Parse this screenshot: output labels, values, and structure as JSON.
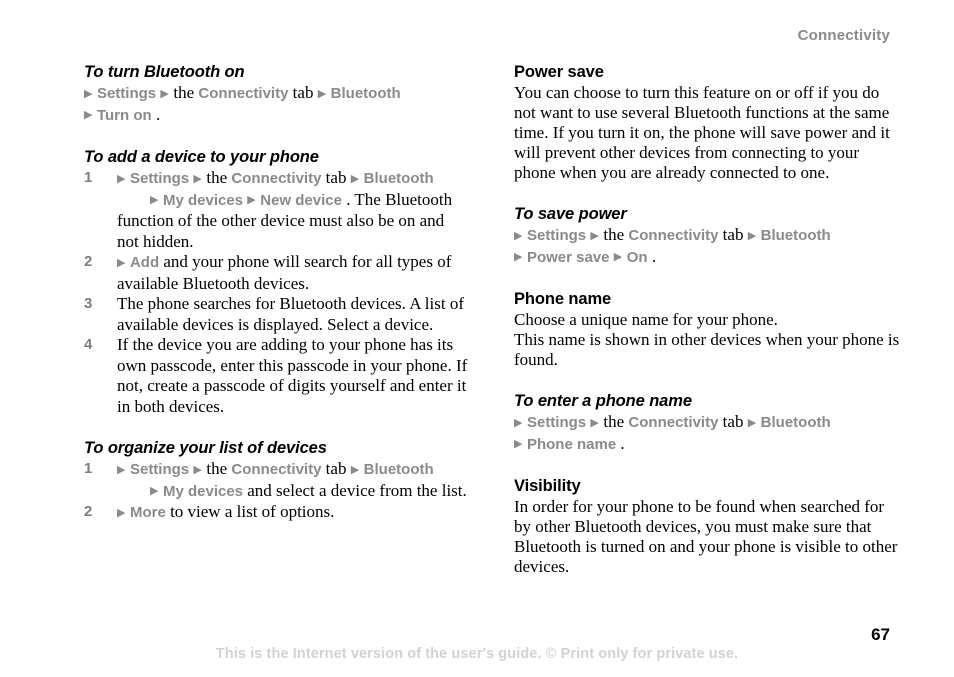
{
  "header": {
    "chapter": "Connectivity"
  },
  "footer": {
    "note": "This is the Internet version of the user's guide. © Print only for private use.",
    "page_number": "67"
  },
  "icons": {
    "menu_arrow": "▶"
  },
  "colors": {
    "ui_term_gray": "#8a8a8a",
    "step_number_gray": "#7d7d7d",
    "header_gray": "#8a8a8a",
    "footer_gray": "#d2d2d2",
    "body_black": "#000000"
  },
  "left_column": {
    "sections": [
      {
        "heading": "To turn Bluetooth on",
        "heading_style": "task",
        "lines": [
          {
            "type": "path",
            "parts": [
              {
                "t": "arrow"
              },
              {
                "t": "ui",
                "v": "Settings"
              },
              {
                "t": "arrow"
              },
              {
                "t": "plain",
                "v": "the "
              },
              {
                "t": "ui",
                "v": "Connectivity"
              },
              {
                "t": "plain",
                "v": " tab "
              },
              {
                "t": "arrow"
              },
              {
                "t": "ui",
                "v": "Bluetooth"
              }
            ]
          },
          {
            "type": "path",
            "parts": [
              {
                "t": "arrow"
              },
              {
                "t": "ui",
                "v": "Turn on"
              },
              {
                "t": "plain",
                "v": "."
              }
            ]
          }
        ]
      },
      {
        "heading": "To add a device to your phone",
        "heading_style": "task",
        "steps": [
          {
            "num": "1",
            "lines": [
              {
                "type": "path",
                "parts": [
                  {
                    "t": "arrow"
                  },
                  {
                    "t": "ui",
                    "v": "Settings"
                  },
                  {
                    "t": "arrow"
                  },
                  {
                    "t": "plain",
                    "v": "the "
                  },
                  {
                    "t": "ui",
                    "v": "Connectivity"
                  },
                  {
                    "t": "plain",
                    "v": " tab "
                  },
                  {
                    "t": "arrow"
                  },
                  {
                    "t": "ui",
                    "v": "Bluetooth"
                  }
                ]
              },
              {
                "type": "path-indent",
                "parts": [
                  {
                    "t": "arrow"
                  },
                  {
                    "t": "ui",
                    "v": "My devices"
                  },
                  {
                    "t": "arrow"
                  },
                  {
                    "t": "ui",
                    "v": "New device"
                  },
                  {
                    "t": "plain",
                    "v": ". The Bluetooth"
                  }
                ]
              },
              {
                "type": "plain",
                "parts": [
                  {
                    "t": "plain",
                    "v": "function of the other device must also be on and not hidden."
                  }
                ]
              }
            ]
          },
          {
            "num": "2",
            "lines": [
              {
                "type": "path",
                "parts": [
                  {
                    "t": "arrow"
                  },
                  {
                    "t": "ui",
                    "v": "Add"
                  },
                  {
                    "t": "plain",
                    "v": " and your phone will search for all types of available Bluetooth devices."
                  }
                ]
              }
            ]
          },
          {
            "num": "3",
            "lines": [
              {
                "type": "plain",
                "parts": [
                  {
                    "t": "plain",
                    "v": "The phone searches for Bluetooth devices. A list of available devices is displayed. Select a device."
                  }
                ]
              }
            ]
          },
          {
            "num": "4",
            "lines": [
              {
                "type": "plain",
                "parts": [
                  {
                    "t": "plain",
                    "v": "If the device you are adding to your phone has its own passcode, enter this passcode in your phone. If not, create a passcode of digits yourself and enter it in both devices."
                  }
                ]
              }
            ]
          }
        ]
      },
      {
        "heading": "To organize your list of devices",
        "heading_style": "task",
        "steps": [
          {
            "num": "1",
            "lines": [
              {
                "type": "path",
                "parts": [
                  {
                    "t": "arrow"
                  },
                  {
                    "t": "ui",
                    "v": "Settings"
                  },
                  {
                    "t": "arrow"
                  },
                  {
                    "t": "plain",
                    "v": "the "
                  },
                  {
                    "t": "ui",
                    "v": "Connectivity"
                  },
                  {
                    "t": "plain",
                    "v": " tab "
                  },
                  {
                    "t": "arrow"
                  },
                  {
                    "t": "ui",
                    "v": "Bluetooth"
                  }
                ]
              },
              {
                "type": "path-indent",
                "parts": [
                  {
                    "t": "arrow"
                  },
                  {
                    "t": "ui",
                    "v": "My devices"
                  },
                  {
                    "t": "plain",
                    "v": " and select a device from the list."
                  }
                ]
              }
            ]
          },
          {
            "num": "2",
            "lines": [
              {
                "type": "path",
                "parts": [
                  {
                    "t": "arrow"
                  },
                  {
                    "t": "ui",
                    "v": "More"
                  },
                  {
                    "t": "plain",
                    "v": " to view a list of options."
                  }
                ]
              }
            ]
          }
        ]
      }
    ]
  },
  "right_column": {
    "sections": [
      {
        "heading": "Power save",
        "heading_style": "topic",
        "lines": [
          {
            "type": "plain",
            "parts": [
              {
                "t": "plain",
                "v": "You can choose to turn this feature on or off if you do not want to use several Bluetooth functions at the same time. If you turn it on, the phone will save power and it will prevent other devices from connecting to your phone when you are already connected to one."
              }
            ]
          }
        ]
      },
      {
        "heading": "To save power",
        "heading_style": "task",
        "lines": [
          {
            "type": "path",
            "parts": [
              {
                "t": "arrow"
              },
              {
                "t": "ui",
                "v": "Settings"
              },
              {
                "t": "arrow"
              },
              {
                "t": "plain",
                "v": "the "
              },
              {
                "t": "ui",
                "v": "Connectivity"
              },
              {
                "t": "plain",
                "v": " tab "
              },
              {
                "t": "arrow"
              },
              {
                "t": "ui",
                "v": "Bluetooth"
              }
            ]
          },
          {
            "type": "path",
            "parts": [
              {
                "t": "arrow"
              },
              {
                "t": "ui",
                "v": "Power save"
              },
              {
                "t": "arrow"
              },
              {
                "t": "ui",
                "v": "On"
              },
              {
                "t": "plain",
                "v": "."
              }
            ]
          }
        ]
      },
      {
        "heading": "Phone name",
        "heading_style": "topic",
        "lines": [
          {
            "type": "plain",
            "parts": [
              {
                "t": "plain",
                "v": "Choose a unique name for your phone."
              }
            ]
          },
          {
            "type": "plain",
            "parts": [
              {
                "t": "plain",
                "v": "This name is shown in other devices when your phone is found."
              }
            ]
          }
        ]
      },
      {
        "heading": "To enter a phone name",
        "heading_style": "task",
        "lines": [
          {
            "type": "path",
            "parts": [
              {
                "t": "arrow"
              },
              {
                "t": "ui",
                "v": "Settings"
              },
              {
                "t": "arrow"
              },
              {
                "t": "plain",
                "v": "the "
              },
              {
                "t": "ui",
                "v": "Connectivity"
              },
              {
                "t": "plain",
                "v": " tab "
              },
              {
                "t": "arrow"
              },
              {
                "t": "ui",
                "v": "Bluetooth"
              }
            ]
          },
          {
            "type": "path",
            "parts": [
              {
                "t": "arrow"
              },
              {
                "t": "ui",
                "v": "Phone name"
              },
              {
                "t": "plain",
                "v": "."
              }
            ]
          }
        ]
      },
      {
        "heading": "Visibility",
        "heading_style": "topic",
        "lines": [
          {
            "type": "plain",
            "parts": [
              {
                "t": "plain",
                "v": "In order for your phone to be found when searched for by other Bluetooth devices, you must make sure that Bluetooth is turned on and your phone is visible to other devices."
              }
            ]
          }
        ]
      }
    ]
  }
}
